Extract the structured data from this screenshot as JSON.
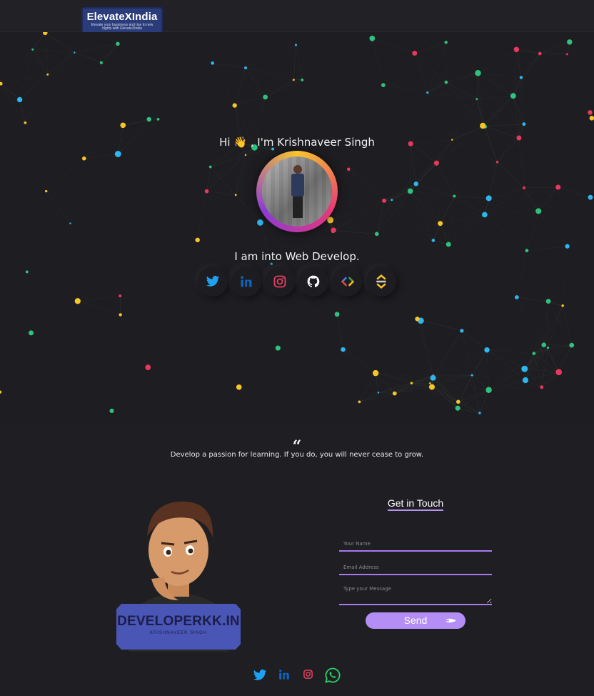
{
  "header": {
    "logo_name": "ElevateXIndia",
    "logo_tagline": "Elevate your bussiness and rise to new hights with ElevateXIndia"
  },
  "hero": {
    "greeting": "Hi 👋 , I'm Krishnaveer Singh",
    "intro": "I am into Web Develop.",
    "social_links": [
      {
        "icon": "twitter-icon",
        "color": "#1da1f2"
      },
      {
        "icon": "linkedin-icon",
        "color": "#0a66c2"
      },
      {
        "icon": "instagram-icon",
        "color": "#e4405f"
      },
      {
        "icon": "github-icon",
        "color": "#ffffff"
      },
      {
        "icon": "code-icon",
        "color": "#4285f4"
      },
      {
        "icon": "hashnode-icon",
        "color": "#f7c52a"
      }
    ]
  },
  "quote": {
    "mark": "“",
    "text": "Develop a passion for learning. If you do, you will never cease to grow."
  },
  "brand_card": {
    "title": "DEVELOPERKK.IN",
    "subtitle": "KRISHNAVEER SINGH"
  },
  "contact": {
    "title": "Get in Touch",
    "name_placeholder": "Your Name",
    "email_placeholder": "Email Address",
    "message_placeholder": "Type your Message",
    "send_label": "Send"
  },
  "footer": {
    "icons": [
      "twitter-icon",
      "linkedin-icon",
      "instagram-icon",
      "whatsapp-icon"
    ]
  },
  "colors": {
    "background": "#1e1d21",
    "accent": "#b48ef5",
    "particle_colors": [
      "#f7c52a",
      "#e7385d",
      "#2ec27e",
      "#2fb6f0"
    ]
  }
}
